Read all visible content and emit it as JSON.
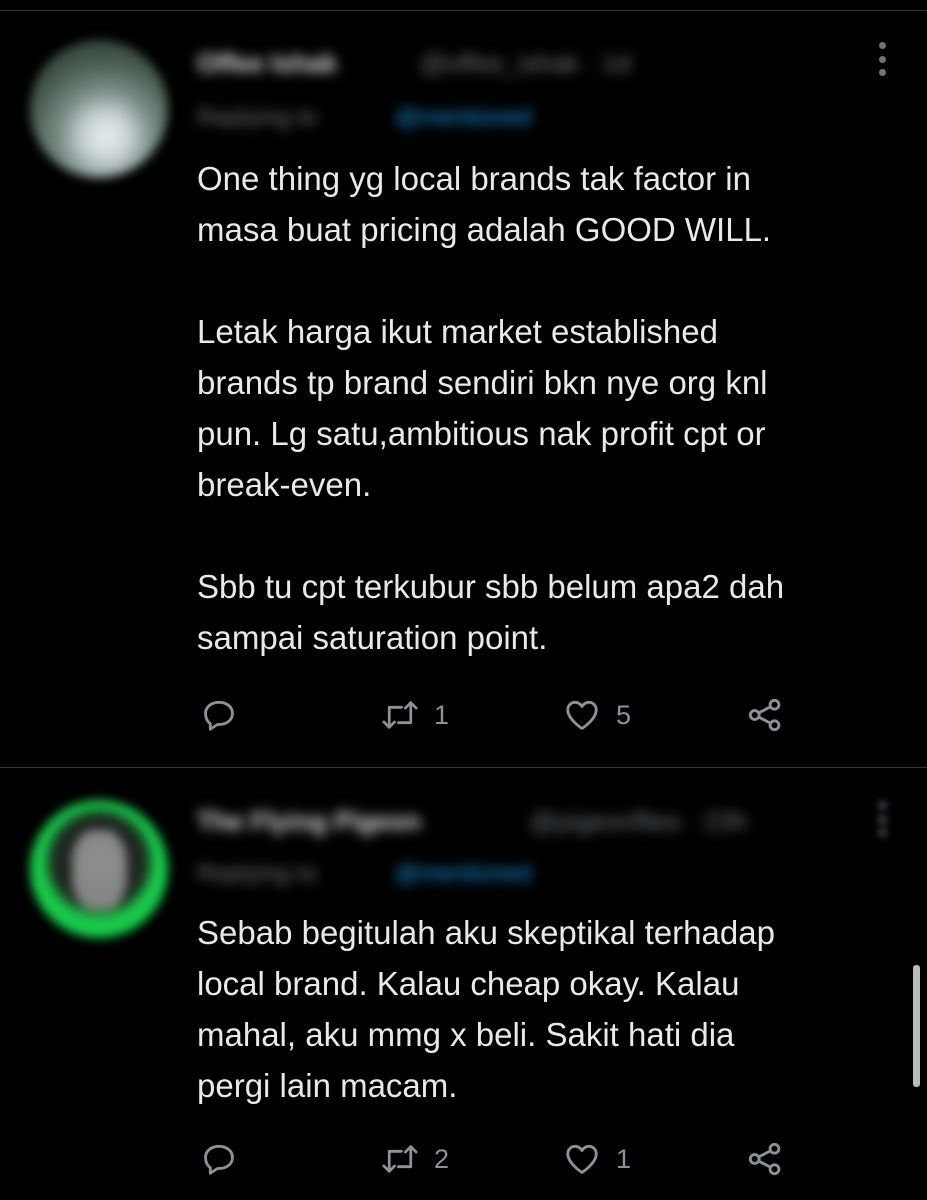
{
  "tweets": [
    {
      "author_name": "Offee Ishak",
      "author_handle": "@offee_ishak · 1d",
      "replying_to_label": "Replying to",
      "replying_to_handle": "@mentioned",
      "text": "One thing yg local brands tak factor in\nmasa buat pricing adalah GOOD WILL.\n\nLetak harga ikut market established\nbrands tp brand sendiri bkn nye org knl\npun. Lg satu,ambitious nak profit cpt or\nbreak-even.\n\nSbb tu cpt terkubur sbb belum apa2 dah\nsampai saturation point.",
      "retweets": "1",
      "likes": "5"
    },
    {
      "author_name": "The Flying Pigeon",
      "author_handle": "@pigeonflies · 23h",
      "replying_to_label": "Replying to",
      "replying_to_handle": "@mentioned",
      "text": "Sebab begitulah aku skeptikal terhadap\nlocal brand. Kalau cheap okay. Kalau\nmahal, aku mmg x beli. Sakit hati dia\npergi lain macam.",
      "retweets": "2",
      "likes": "1"
    }
  ],
  "icons": {
    "reply": "reply-icon",
    "retweet": "retweet-icon",
    "like": "heart-icon",
    "share": "share-icon",
    "more": "more-vertical-icon"
  },
  "colors": {
    "background": "#000000",
    "text": "#e7e9ea",
    "secondary": "#6e767d",
    "link": "#1d9bf0",
    "avatar_ring": "#19d14e"
  }
}
